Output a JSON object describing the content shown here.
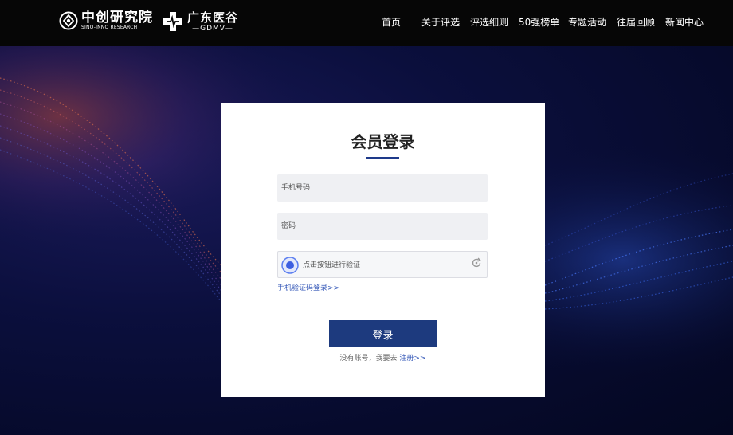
{
  "header": {
    "logo1": {
      "name_cn": "中创研究院",
      "name_en": "SINO-INNO RESEARCH"
    },
    "logo2": {
      "name_cn": "广东医谷",
      "name_en": "—GDMV—"
    },
    "nav": [
      {
        "label": "首页"
      },
      {
        "label": "关于评选"
      },
      {
        "label": "评选细则"
      },
      {
        "label": "50强榜单"
      },
      {
        "label": "专题活动"
      },
      {
        "label": "往届回顾"
      },
      {
        "label": "新闻中心"
      }
    ]
  },
  "login": {
    "title": "会员登录",
    "phone_placeholder": "手机号码",
    "password_placeholder": "密码",
    "captcha_text": "点击按钮进行验证",
    "sms_login_link": "手机验证码登录>>",
    "submit_label": "登录",
    "no_account_text": "没有账号，我要去",
    "register_link": "注册>>"
  },
  "colors": {
    "header_bg": "#060606",
    "accent": "#1d3a7e",
    "link": "#3558b8",
    "field_bg": "#eff0f3"
  }
}
